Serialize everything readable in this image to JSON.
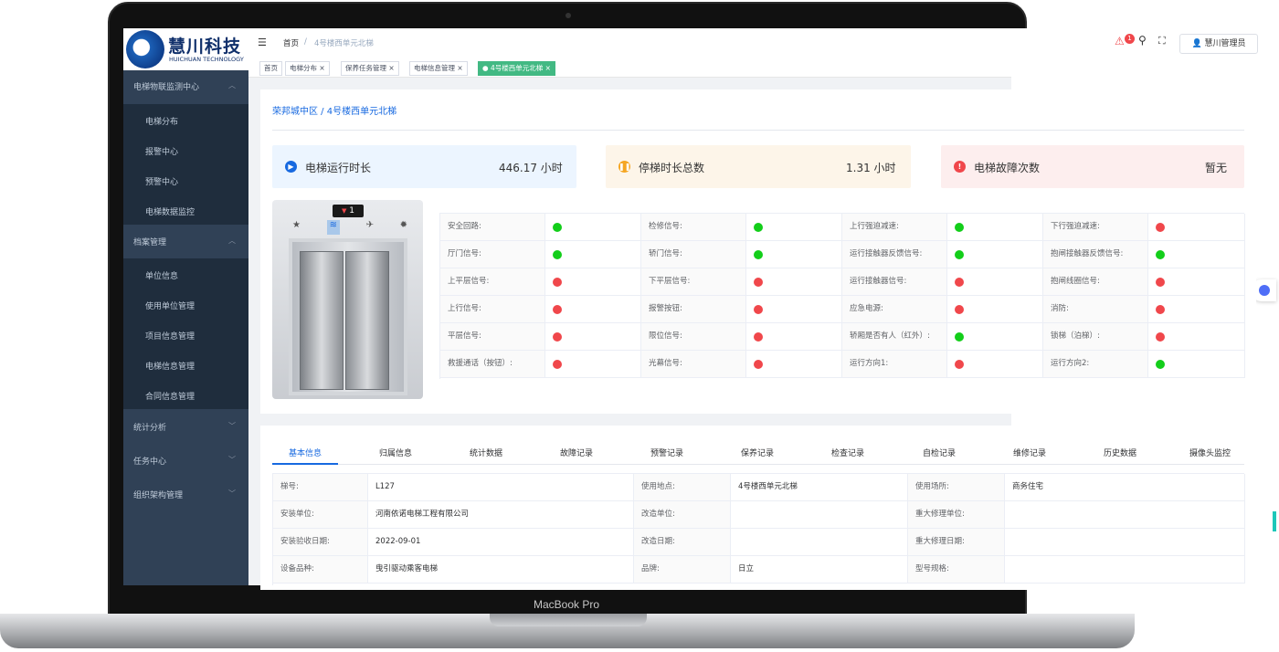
{
  "brand": {
    "cn": "慧川科技",
    "en": "HUICHUAN TECHNOLOGY"
  },
  "device_label": "MacBook Pro",
  "header": {
    "breadcrumb_home": "首页",
    "breadcrumb_sep": "/",
    "breadcrumb_current": "4号楼西单元北梯",
    "notif_count": "1",
    "user": "慧川管理员"
  },
  "tags": [
    {
      "label": "首页"
    },
    {
      "label": "电梯分布"
    },
    {
      "label": "保养任务管理"
    },
    {
      "label": "电梯信息管理"
    },
    {
      "label": "4号楼西单元北梯"
    }
  ],
  "sidebar": {
    "groups": [
      {
        "label": "电梯物联监测中心"
      },
      {
        "label": "档案管理"
      },
      {
        "label": "统计分析"
      },
      {
        "label": "任务中心"
      },
      {
        "label": "组织架构管理"
      }
    ],
    "monitor_items": [
      "电梯分布",
      "报警中心",
      "预警中心",
      "电梯数据监控"
    ],
    "archive_items": [
      "单位信息",
      "使用单位管理",
      "项目信息管理",
      "电梯信息管理",
      "合同信息管理"
    ]
  },
  "location": "荣邦城中区 / 4号楼西单元北梯",
  "stats": [
    {
      "label": "电梯运行时长",
      "value": "446.17 小时",
      "bg": "#ecf5ff",
      "icon_color": "#1769e0"
    },
    {
      "label": "停梯时长总数",
      "value": "1.31 小时",
      "bg": "#fdf5e9",
      "icon_color": "#f5a623"
    },
    {
      "label": "电梯故障次数",
      "value": "暂无",
      "bg": "#fdeeee",
      "icon_color": "#f0474b"
    }
  ],
  "elevator": {
    "floor": "1",
    "direction": "▼"
  },
  "signals": [
    [
      {
        "label": "安全回路:",
        "status": "g"
      },
      {
        "label": "检修信号:",
        "status": "g"
      },
      {
        "label": "上行强迫减速:",
        "status": "g"
      },
      {
        "label": "下行强迫减速:",
        "status": "r"
      }
    ],
    [
      {
        "label": "厅门信号:",
        "status": "g"
      },
      {
        "label": "轿门信号:",
        "status": "g"
      },
      {
        "label": "运行接触器反馈信号:",
        "status": "g"
      },
      {
        "label": "抱闸接触器反馈信号:",
        "status": "g"
      }
    ],
    [
      {
        "label": "上平层信号:",
        "status": "r"
      },
      {
        "label": "下平层信号:",
        "status": "r"
      },
      {
        "label": "运行接触器信号:",
        "status": "r"
      },
      {
        "label": "抱闸线圈信号:",
        "status": "r"
      }
    ],
    [
      {
        "label": "上行信号:",
        "status": "r"
      },
      {
        "label": "报警按钮:",
        "status": "r"
      },
      {
        "label": "应急电源:",
        "status": "r"
      },
      {
        "label": "消防:",
        "status": "r"
      }
    ],
    [
      {
        "label": "平层信号:",
        "status": "r"
      },
      {
        "label": "限位信号:",
        "status": "r"
      },
      {
        "label": "轿厢是否有人（红外）:",
        "status": "g"
      },
      {
        "label": "锁梯（泊梯）:",
        "status": "r"
      }
    ],
    [
      {
        "label": "救援通话（按钮）:",
        "status": "r"
      },
      {
        "label": "光幕信号:",
        "status": "r"
      },
      {
        "label": "运行方向1:",
        "status": "r"
      },
      {
        "label": "运行方向2:",
        "status": "g"
      }
    ]
  ],
  "tabs": [
    "基本信息",
    "归属信息",
    "统计数据",
    "故障记录",
    "预警记录",
    "保养记录",
    "检查记录",
    "自检记录",
    "维修记录",
    "历史数据",
    "摄像头监控"
  ],
  "info_rows": [
    [
      "梯号:",
      "L127",
      "使用地点:",
      "4号楼西单元北梯",
      "使用场所:",
      "商务住宅"
    ],
    [
      "安装单位:",
      "河南依诺电梯工程有限公司",
      "改造单位:",
      "",
      "重大修理单位:",
      ""
    ],
    [
      "安装验收日期:",
      "2022-09-01",
      "改造日期:",
      "",
      "重大修理日期:",
      ""
    ],
    [
      "设备品种:",
      "曳引驱动乘客电梯",
      "品牌:",
      "日立",
      "型号规格:",
      ""
    ]
  ],
  "colors": {
    "sidebar": "#304156",
    "submenu": "#1f2d3d",
    "accent": "#1769e0",
    "tag_active": "#42b983"
  }
}
